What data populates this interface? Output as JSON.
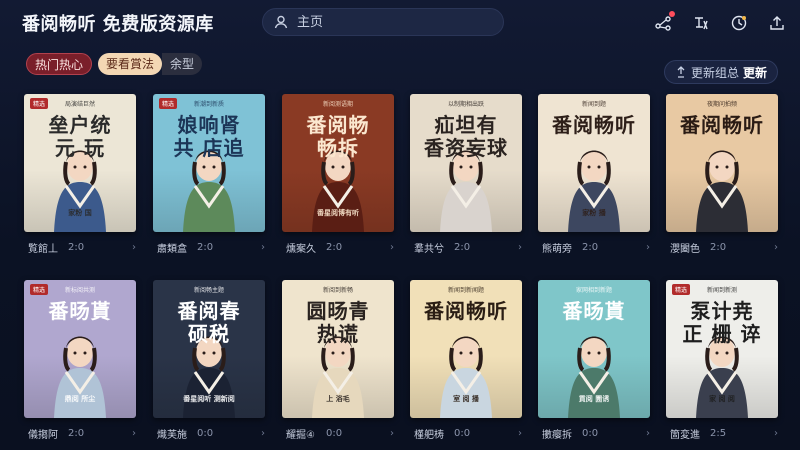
{
  "app_title": "番阅畅听 免费版资源库",
  "search": {
    "placeholder": "主页"
  },
  "top_icons": [
    "share-icon",
    "translate-icon",
    "clock-icon",
    "upload-icon"
  ],
  "chips": [
    "热门热心",
    "要看賞法",
    "余型"
  ],
  "update_button": {
    "prefix": "更新组总",
    "bold": "更新"
  },
  "covers": [
    {
      "title": "垒户统\n元 玩",
      "subtitle": "局演结巨然",
      "tag": "精选",
      "footer": "家粉 国",
      "name": "覧館丄",
      "time": "2:0",
      "bg": "#ece6d6",
      "title_color": "#2a2a2a",
      "figure": "#3c5a8c"
    },
    {
      "title": "娘响肾\n共 店追",
      "subtitle": "新潮到新质",
      "tag": "精选",
      "footer": "",
      "name": "肅類盒",
      "time": "2:0",
      "bg": "#7fc2d6",
      "title_color": "#1c3557",
      "figure": "#5d8a5b"
    },
    {
      "title": "番阅畅\n畅拆",
      "subtitle": "新阅测语期",
      "tag": "",
      "footer": "番星阅博有听",
      "name": "燻案久",
      "time": "2:0",
      "bg": "#8a3a24",
      "title_color": "#fbe7cf",
      "figure": "#5a1e14"
    },
    {
      "title": "疝坦有\n香资妄球",
      "subtitle": "以制期相出跃",
      "tag": "",
      "footer": "",
      "name": "羣共兮",
      "time": "2:0",
      "bg": "#e6dccb",
      "title_color": "#2a2320",
      "figure": "#d9d3ce"
    },
    {
      "title": "番阅畅听",
      "subtitle": "新闻到题",
      "tag": "",
      "footer": "家粉 播",
      "name": "熊萌旁",
      "time": "2:0",
      "bg": "#efe4d2",
      "title_color": "#2e1f19",
      "figure": "#3d4760"
    },
    {
      "title": "番阅畅听",
      "subtitle": "夜期问拍频",
      "tag": "",
      "footer": "",
      "name": "瀴闔色",
      "time": "2:0",
      "bg": "#e8c9a3",
      "title_color": "#2a1b14",
      "figure": "#2c2d35"
    },
    {
      "title": "番旸貰",
      "subtitle": "新标阅共测",
      "tag": "精选",
      "footer": "鼎阅 所尘",
      "name": "儀搊阿",
      "time": "2:0",
      "bg": "#b0a7cf",
      "title_color": "#ffffff",
      "figure": "#b0c3d6"
    },
    {
      "title": "番阅春\n硕税",
      "subtitle": "新阅畅主题",
      "tag": "",
      "footer": "番星阅听 测新阅",
      "name": "熾芙施",
      "time": "0:0",
      "bg": "#2a3448",
      "title_color": "#ffffff",
      "figure": "#1b2233"
    },
    {
      "title": "圆旸青\n热谎",
      "subtitle": "新阅到新畅",
      "tag": "",
      "footer": "上 浴毛",
      "name": "耀掘④",
      "time": "0:0",
      "bg": "#efe4cd",
      "title_color": "#2a2320",
      "figure": "#e6d8bd"
    },
    {
      "title": "番阅畅听",
      "subtitle": "新闻到新闻题",
      "tag": "",
      "footer": "室 阅 播",
      "name": "槿舥梼",
      "time": "0:0",
      "bg": "#f1e0b8",
      "title_color": "#2a1d14",
      "figure": "#c9d6e0"
    },
    {
      "title": "番旸貰",
      "subtitle": "家网相到新题",
      "tag": "",
      "footer": "貢阅 圊诱",
      "name": "擻瘿拆",
      "time": "0:0",
      "bg": "#7fc6c9",
      "title_color": "#ffffff",
      "figure": "#4c7a6a"
    },
    {
      "title": "泵计尭\n正 栅 谇",
      "subtitle": "新闻到新测",
      "tag": "精选",
      "footer": "家 阅 阅",
      "name": "箇変進",
      "time": "2:5",
      "bg": "#eeeeea",
      "title_color": "#1e1e1e",
      "figure": "#3a3f4e"
    }
  ]
}
